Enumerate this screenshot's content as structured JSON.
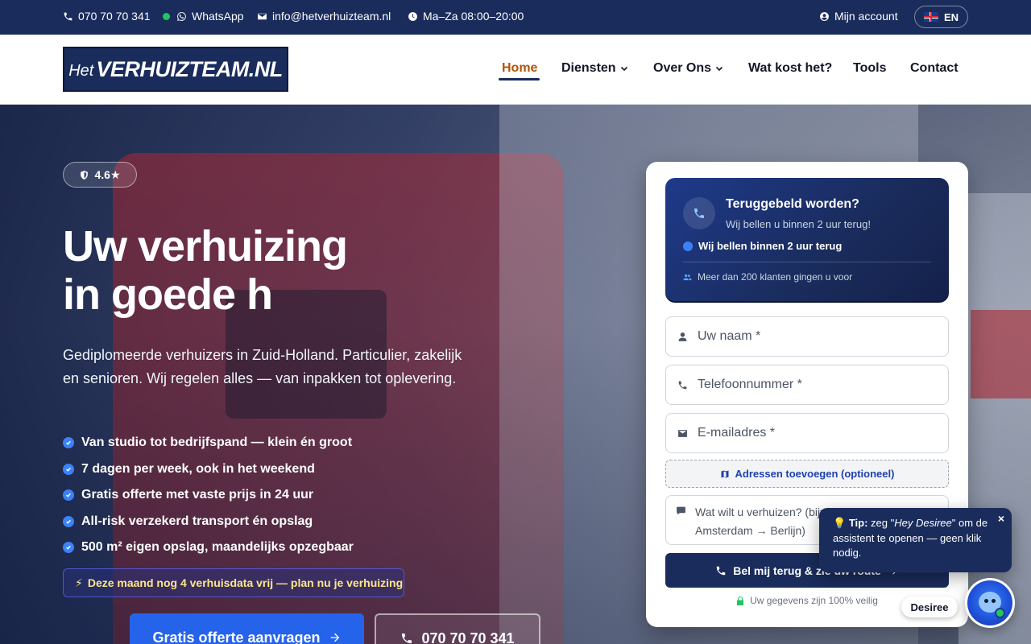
{
  "topbar": {
    "phone": "070 70 70 341",
    "whatsapp": "WhatsApp",
    "email": "info@hetverhuizteam.nl",
    "hours": "Ma–Za 08:00–20:00",
    "account": "Mijn account",
    "language": "EN"
  },
  "header": {
    "logo_het": "Het",
    "logo_main": "VERHUIZTEAM.NL",
    "nav": [
      "Home",
      "Diensten",
      "Over Ons",
      "Wat kost het?",
      "Tools",
      "Contact"
    ],
    "active_nav": "Home"
  },
  "hero": {
    "rating": "4.6★",
    "title_line1": "Uw verhuizing",
    "title_line2": "in goede h",
    "subtitle": "Gediplomeerde verhuizers in Zuid-Holland. Particulier, zakelijk en senioren. Wij regelen alles — van inpakken tot oplevering.",
    "checks": [
      "Van studio tot bedrijfspand — klein én groot",
      "7 dagen per week, ook in het weekend",
      "Gratis offerte met vaste prijs in 24 uur",
      "All-risk verzekerd transport én opslag",
      "500 m² eigen opslag, maandelijks opzegbaar"
    ],
    "promo": "Deze maand nog 4 verhuisdata vrij — plan nu je verhuizing",
    "cta_primary": "Gratis offerte aanvragen",
    "cta_phone": "070 70 70 341"
  },
  "form": {
    "callback_title": "Teruggebeld worden?",
    "callback_sub": "Wij bellen u binnen 2 uur terug!",
    "callback_promise": "Wij bellen binnen 2 uur terug",
    "callback_social": "Meer dan 200 klanten gingen u voor",
    "name_placeholder": "Uw naam *",
    "phone_placeholder": "Telefoonnummer *",
    "email_placeholder": "E-mailadres *",
    "addresses": "Adressen toevoegen (optioneel)",
    "message_line1": "Wat wilt u verhuizen? (bijv. 3-kamer flat",
    "message_line2": "Amsterdam → Berlijn)",
    "submit": "Bel mij terug & zie uw route",
    "secure": "Uw gegevens zijn 100% veilig"
  },
  "assistant": {
    "tip_label": "Tip:",
    "tip_text_before": "zeg \"",
    "tip_quote": "Hey Desiree",
    "tip_text_after": "\" om de assistent te openen — geen klik nodig.",
    "close": "×",
    "name": "Desiree"
  },
  "colors": {
    "navy": "#1a2c5c",
    "accent_blue": "#2563eb",
    "active_nav": "#b45309",
    "promo_text": "#fde68a"
  }
}
